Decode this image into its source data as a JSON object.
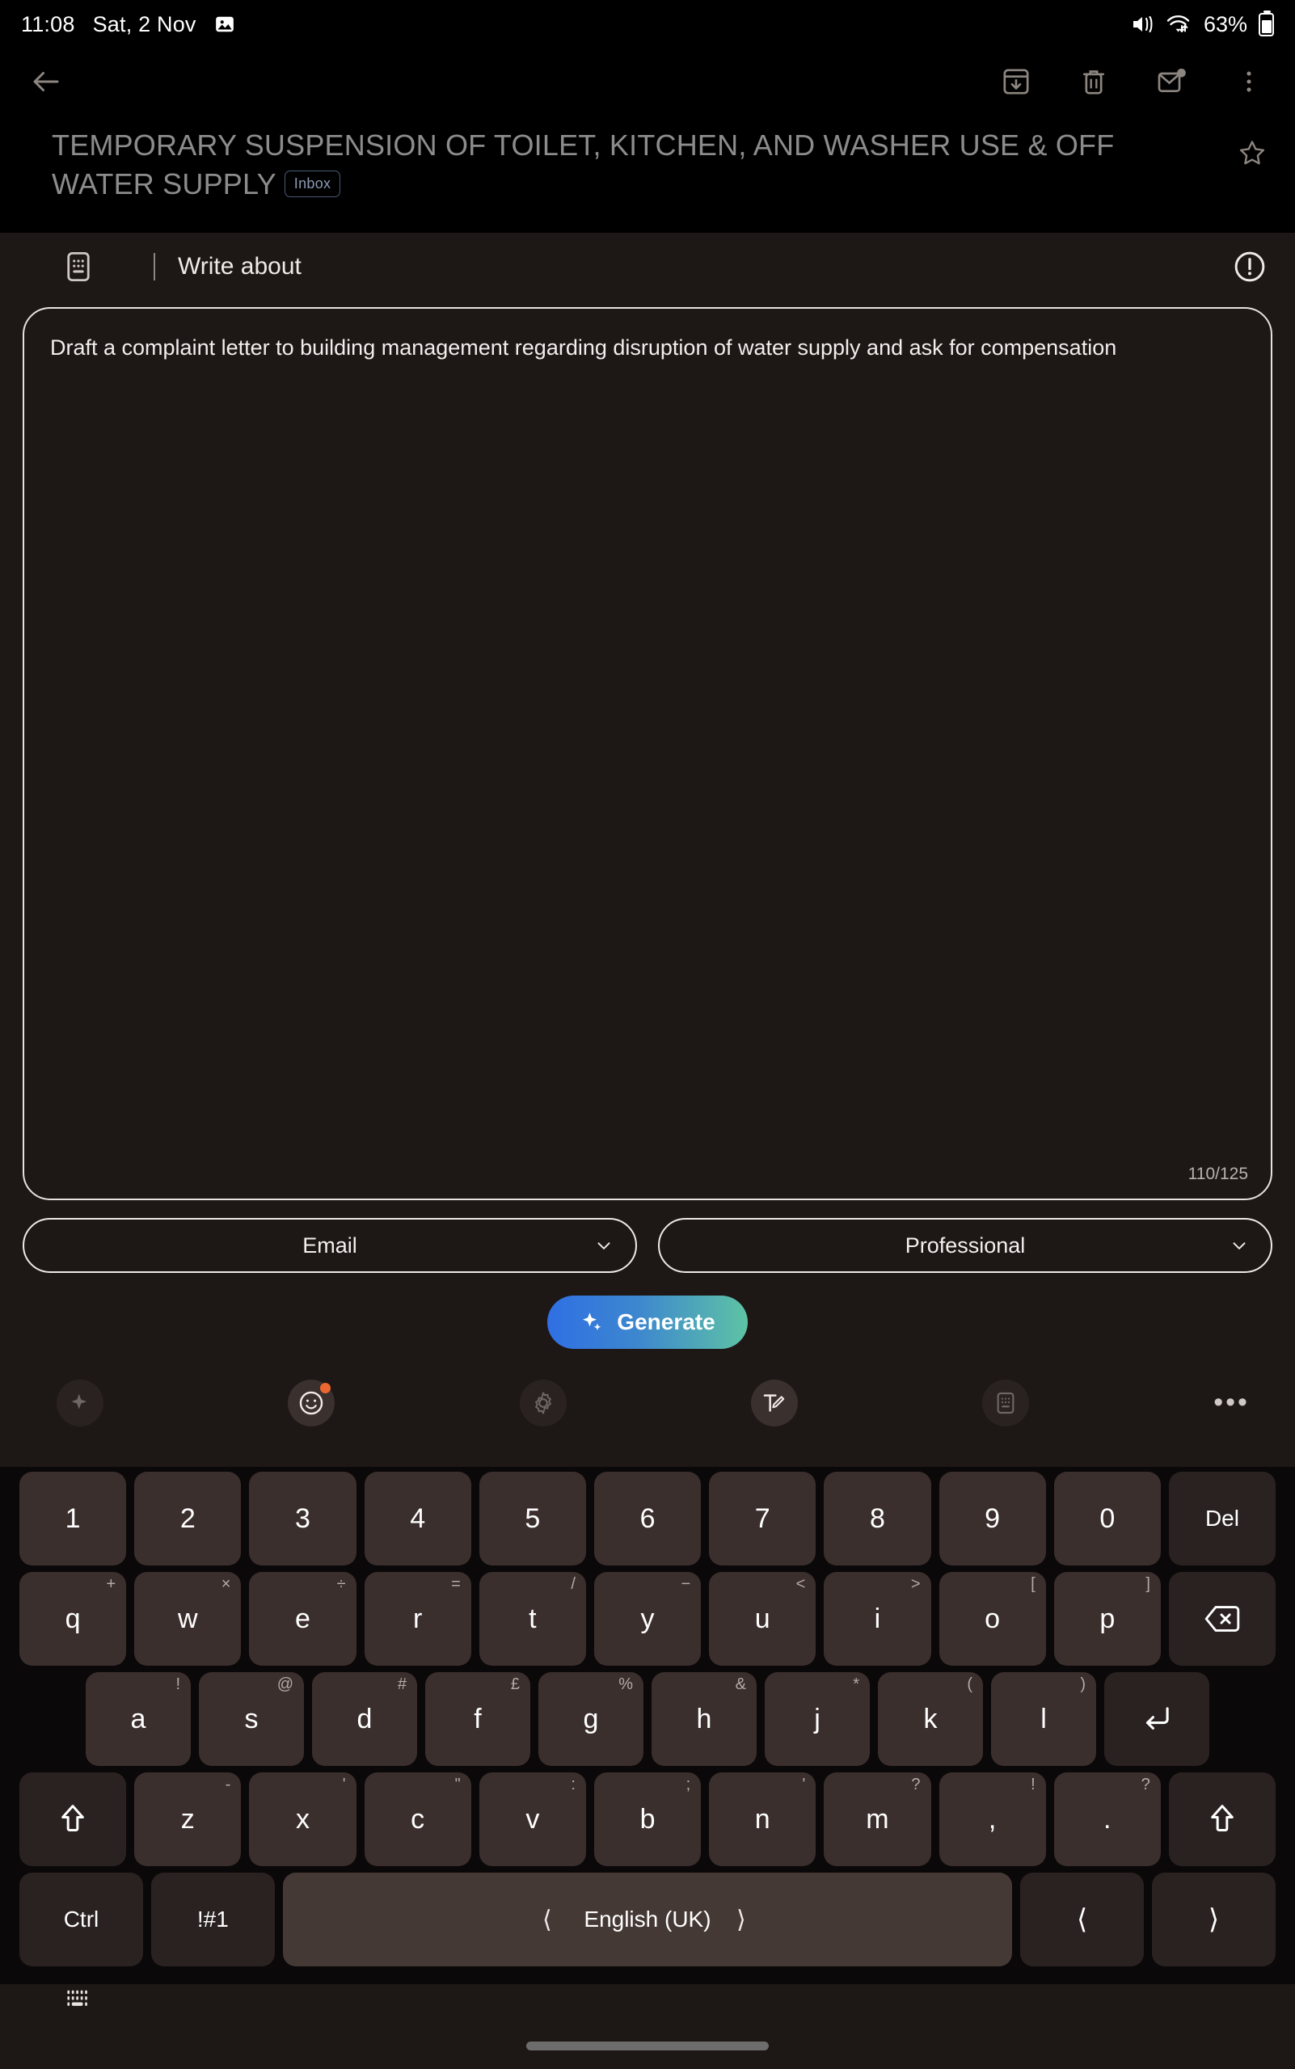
{
  "status_bar": {
    "time": "11:08",
    "date": "Sat, 2 Nov",
    "image_icon": "image-icon",
    "mute_icon": "volume-mute-icon",
    "wifi_icon": "wifi-transfer-icon",
    "battery_text": "63%",
    "battery_icon": "battery-icon"
  },
  "toolbar": {
    "back_icon": "back-arrow-icon",
    "archive_icon": "archive-icon",
    "delete_icon": "trash-icon",
    "unread_icon": "mark-unread-icon",
    "more_icon": "overflow-menu-icon"
  },
  "email": {
    "subject": "TEMPORARY SUSPENSION OF TOILET, KITCHEN, AND WASHER USE & OFF WATER SUPPLY",
    "label": "Inbox",
    "star_icon": "star-outline-icon"
  },
  "ai_panel": {
    "keyboard_icon": "keyboard-icon",
    "title": "Write about",
    "info_icon": "info-circle-icon",
    "prompt_value": "Draft a complaint letter to building management regarding disruption of water supply and ask for compensation",
    "prompt_placeholder": "Write about",
    "counter": "110/125",
    "format_select": {
      "value": "Email",
      "chevron_icon": "chevron-down-icon"
    },
    "tone_select": {
      "value": "Professional",
      "chevron_icon": "chevron-down-icon"
    },
    "generate_label": "Generate",
    "generate_icon": "sparkle-icon",
    "generate_gradient_from": "#2f6fe4",
    "generate_gradient_to": "#5ec3a4"
  },
  "keyboard_toolbar": {
    "items": [
      {
        "name": "ai-sparkle-icon",
        "badge": false
      },
      {
        "name": "emoji-icon",
        "badge": true
      },
      {
        "name": "settings-gear-icon",
        "badge": false
      },
      {
        "name": "text-edit-icon",
        "badge": false
      },
      {
        "name": "keyboard-layout-icon",
        "badge": false
      }
    ],
    "more_label": "•••"
  },
  "keyboard": {
    "row_numbers": [
      {
        "main": "1"
      },
      {
        "main": "2"
      },
      {
        "main": "3"
      },
      {
        "main": "4"
      },
      {
        "main": "5"
      },
      {
        "main": "6"
      },
      {
        "main": "7"
      },
      {
        "main": "8"
      },
      {
        "main": "9"
      },
      {
        "main": "0"
      },
      {
        "main": "Del",
        "fn": true
      }
    ],
    "row_qwerty": [
      {
        "main": "q",
        "sup": "+"
      },
      {
        "main": "w",
        "sup": "×"
      },
      {
        "main": "e",
        "sup": "÷"
      },
      {
        "main": "r",
        "sup": "="
      },
      {
        "main": "t",
        "sup": "/"
      },
      {
        "main": "y",
        "sup": "−"
      },
      {
        "main": "u",
        "sup": "<"
      },
      {
        "main": "i",
        "sup": ">"
      },
      {
        "main": "o",
        "sup": "["
      },
      {
        "main": "p",
        "sup": "]"
      },
      {
        "main": "backspace-icon",
        "fn": true,
        "icon": true
      }
    ],
    "row_home": [
      {
        "main": "a",
        "sup": "!"
      },
      {
        "main": "s",
        "sup": "@"
      },
      {
        "main": "d",
        "sup": "#"
      },
      {
        "main": "f",
        "sup": "£"
      },
      {
        "main": "g",
        "sup": "%"
      },
      {
        "main": "h",
        "sup": "&"
      },
      {
        "main": "j",
        "sup": "*"
      },
      {
        "main": "k",
        "sup": "("
      },
      {
        "main": "l",
        "sup": ")"
      },
      {
        "main": "enter-icon",
        "fn": true,
        "icon": true
      }
    ],
    "row_zxcv": [
      {
        "main": "shift-icon",
        "fn": true,
        "icon": true
      },
      {
        "main": "z",
        "sup": "-"
      },
      {
        "main": "x",
        "sup": "'"
      },
      {
        "main": "c",
        "sup": "\""
      },
      {
        "main": "v",
        "sup": ":"
      },
      {
        "main": "b",
        "sup": ";"
      },
      {
        "main": "n",
        "sup": "'"
      },
      {
        "main": "m",
        "sup": "?"
      },
      {
        "main": ",",
        "sup": "!"
      },
      {
        "main": ".",
        "sup": "?"
      },
      {
        "main": "shift-icon",
        "fn": true,
        "icon": true
      }
    ],
    "row_space": {
      "ctrl": "Ctrl",
      "symbols": "!#1",
      "language": "English (UK)",
      "prev_icon": "chevron-left-icon",
      "next_icon": "chevron-right-icon",
      "arrow_left": "chevron-left-icon",
      "arrow_right": "chevron-right-icon"
    }
  },
  "bottom": {
    "hide_keyboard_icon": "hide-keyboard-icon",
    "home_indicator": "home-indicator"
  }
}
